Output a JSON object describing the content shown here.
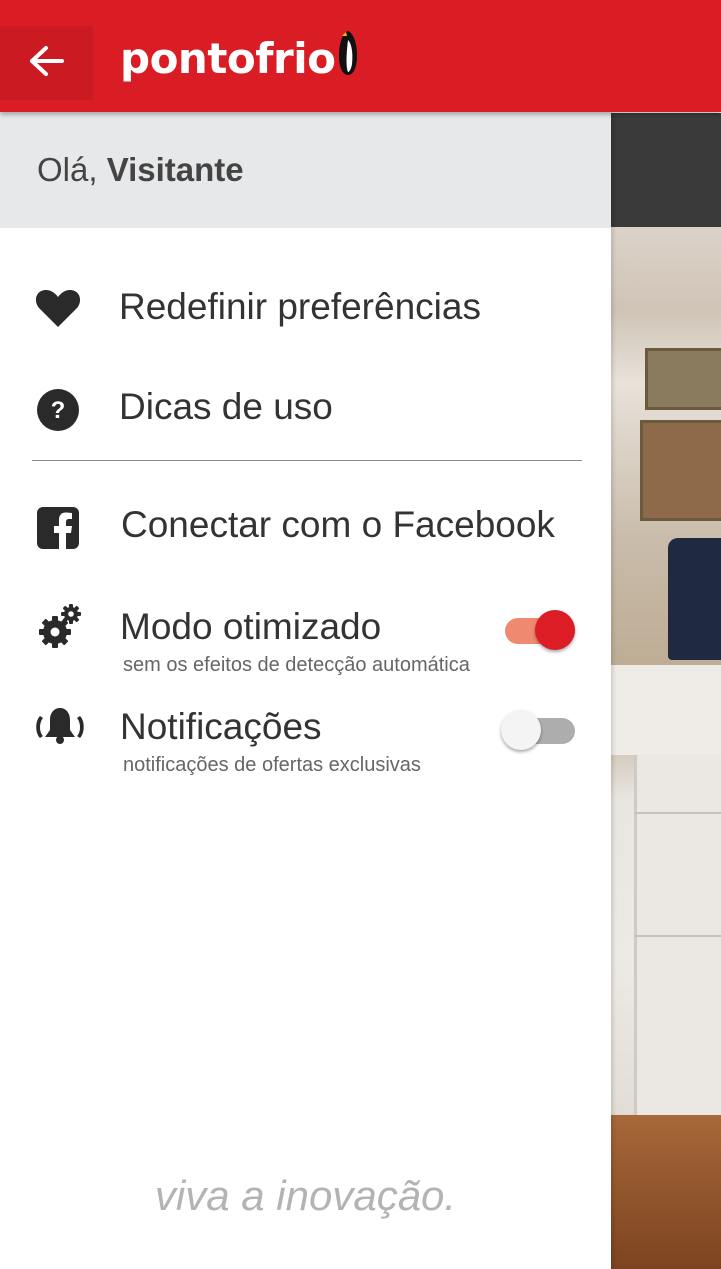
{
  "header": {
    "back_icon": "arrow-left-icon",
    "logo_text": "pontofrio",
    "logo_icon": "penguin-icon",
    "brand_color": "#da1c24"
  },
  "drawer": {
    "greeting_prefix": "Olá,",
    "greeting_name": "Visitante",
    "items": [
      {
        "icon": "heart-icon",
        "label": "Redefinir preferências"
      },
      {
        "icon": "help-circle-icon",
        "label": "Dicas de uso"
      },
      {
        "icon": "facebook-icon",
        "label": "Conectar com o Facebook"
      }
    ],
    "toggles": [
      {
        "icon": "gears-icon",
        "label": "Modo otimizado",
        "sub": "sem os efeitos de detecção automática",
        "on": true
      },
      {
        "icon": "bell-ringing-icon",
        "label": "Notificações",
        "sub": "notificações de ofertas exclusivas",
        "on": false
      }
    ],
    "tagline": "viva a inovação."
  }
}
